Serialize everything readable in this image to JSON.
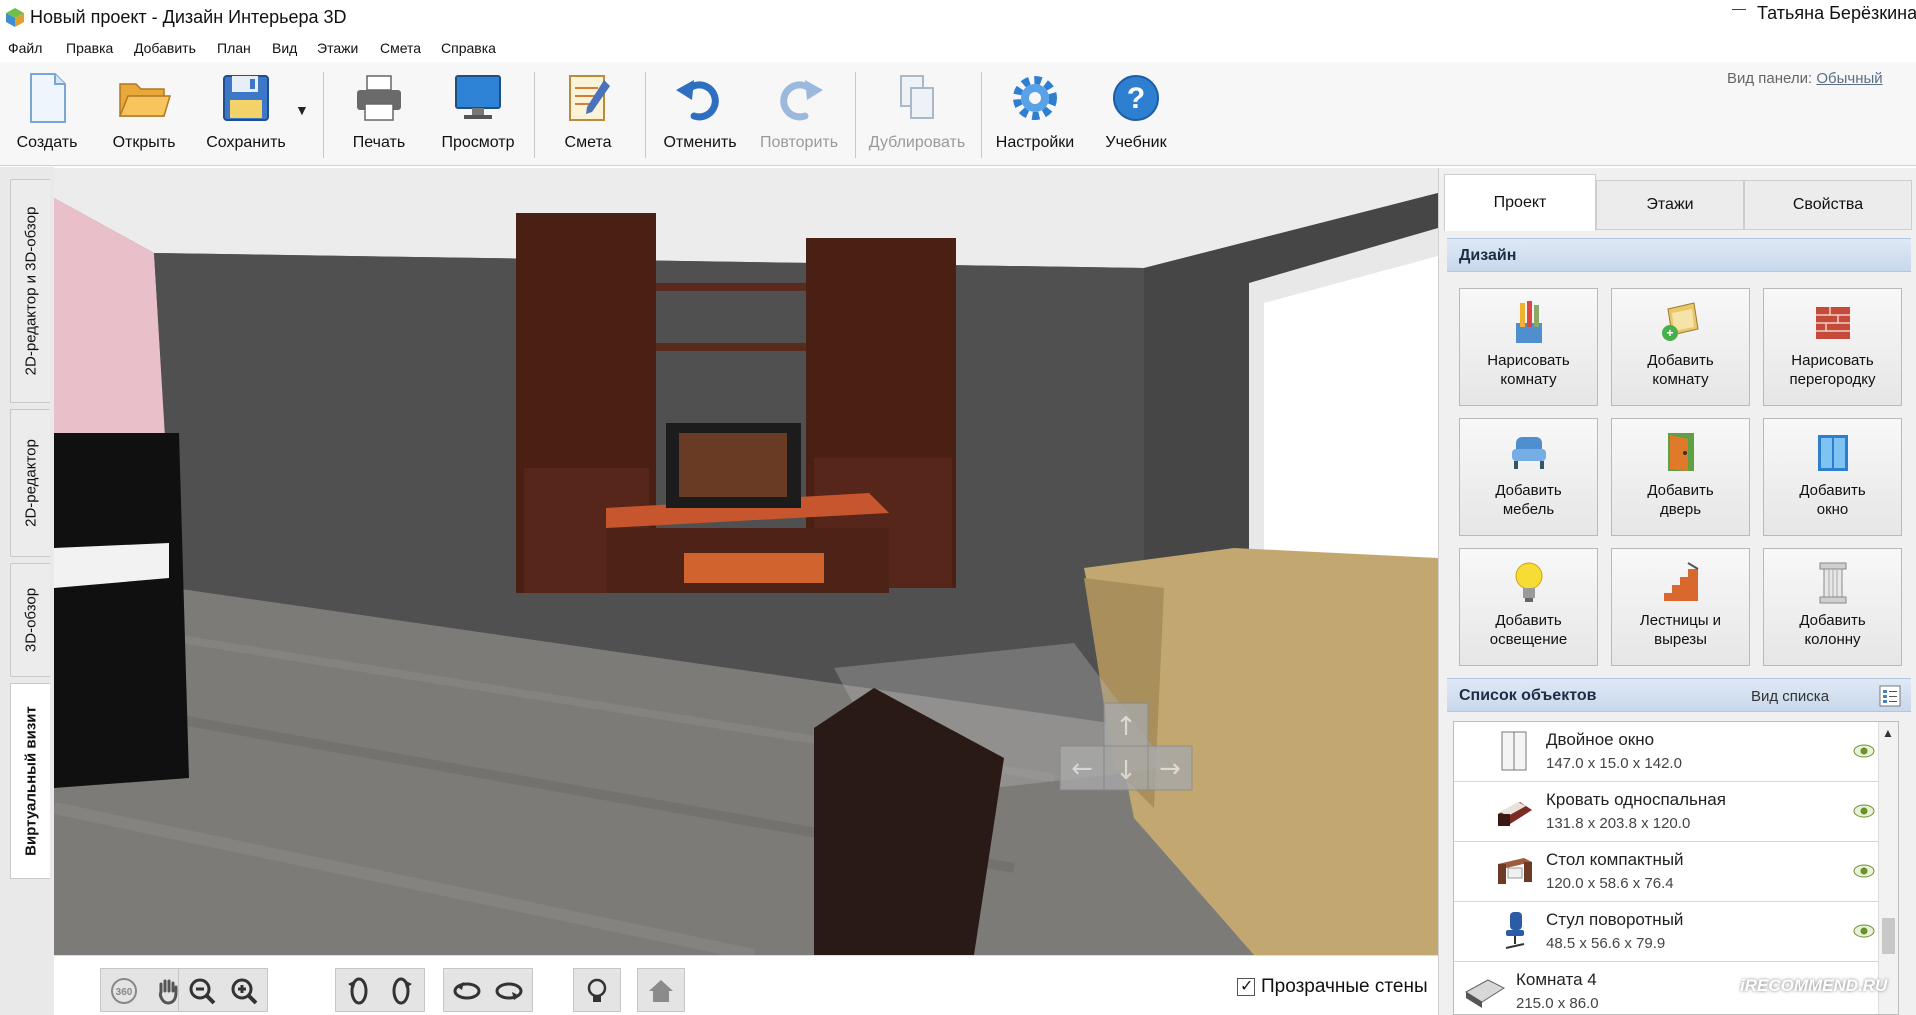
{
  "window": {
    "title": "Новый проект - Дизайн Интерьера 3D",
    "user": "Татьяна Берёзкина"
  },
  "menu": [
    "Файл",
    "Правка",
    "Добавить",
    "План",
    "Вид",
    "Этажи",
    "Смета",
    "Справка"
  ],
  "toolbar": {
    "create": "Создать",
    "open": "Открыть",
    "save": "Сохранить",
    "print": "Печать",
    "preview": "Просмотр",
    "estimate": "Смета",
    "undo": "Отменить",
    "redo": "Повторить",
    "duplicate": "Дублировать",
    "settings": "Настройки",
    "tutorial": "Учебник",
    "panel_view_label": "Вид панели:",
    "panel_view_value": "Обычный"
  },
  "left_tabs": [
    "2D-редактор и 3D-обзор",
    "2D-редактор",
    "3D-обзор",
    "Виртуальный визит"
  ],
  "bottom_bar": {
    "transparent_walls": "Прозрачные стены",
    "rotate_360": "360"
  },
  "right_panel": {
    "tabs": [
      "Проект",
      "Этажи",
      "Свойства"
    ],
    "design_title": "Дизайн",
    "design_buttons": [
      {
        "label": "Нарисовать\nкомнату",
        "icon": "pencils-icon"
      },
      {
        "label": "Добавить\nкомнату",
        "icon": "add-room-icon"
      },
      {
        "label": "Нарисовать\nперегородку",
        "icon": "brick-wall-icon"
      },
      {
        "label": "Добавить\nмебель",
        "icon": "armchair-icon"
      },
      {
        "label": "Добавить\nдверь",
        "icon": "door-icon"
      },
      {
        "label": "Добавить\nокно",
        "icon": "window-icon"
      },
      {
        "label": "Добавить\nосвещение",
        "icon": "lightbulb-icon"
      },
      {
        "label": "Лестницы и\nвырезы",
        "icon": "stairs-icon"
      },
      {
        "label": "Добавить\nколонну",
        "icon": "column-icon"
      }
    ],
    "objects_title": "Список объектов",
    "list_view": "Вид списка",
    "objects": [
      {
        "name": "Двойное окно",
        "dims": "147.0 x 15.0 x 142.0",
        "icon": "double-window-icon"
      },
      {
        "name": "Кровать односпальная",
        "dims": "131.8 x 203.8 x 120.0",
        "icon": "bed-icon"
      },
      {
        "name": "Стол компактный",
        "dims": "120.0 x 58.6 x 76.4",
        "icon": "desk-icon"
      },
      {
        "name": "Стул поворотный",
        "dims": "48.5 x 56.6 x 79.9",
        "icon": "office-chair-icon"
      },
      {
        "name": "Комната 4",
        "dims": "215.0 x 86.0",
        "icon": "room-icon"
      }
    ]
  },
  "watermark": "iRECOMMEND.RU"
}
